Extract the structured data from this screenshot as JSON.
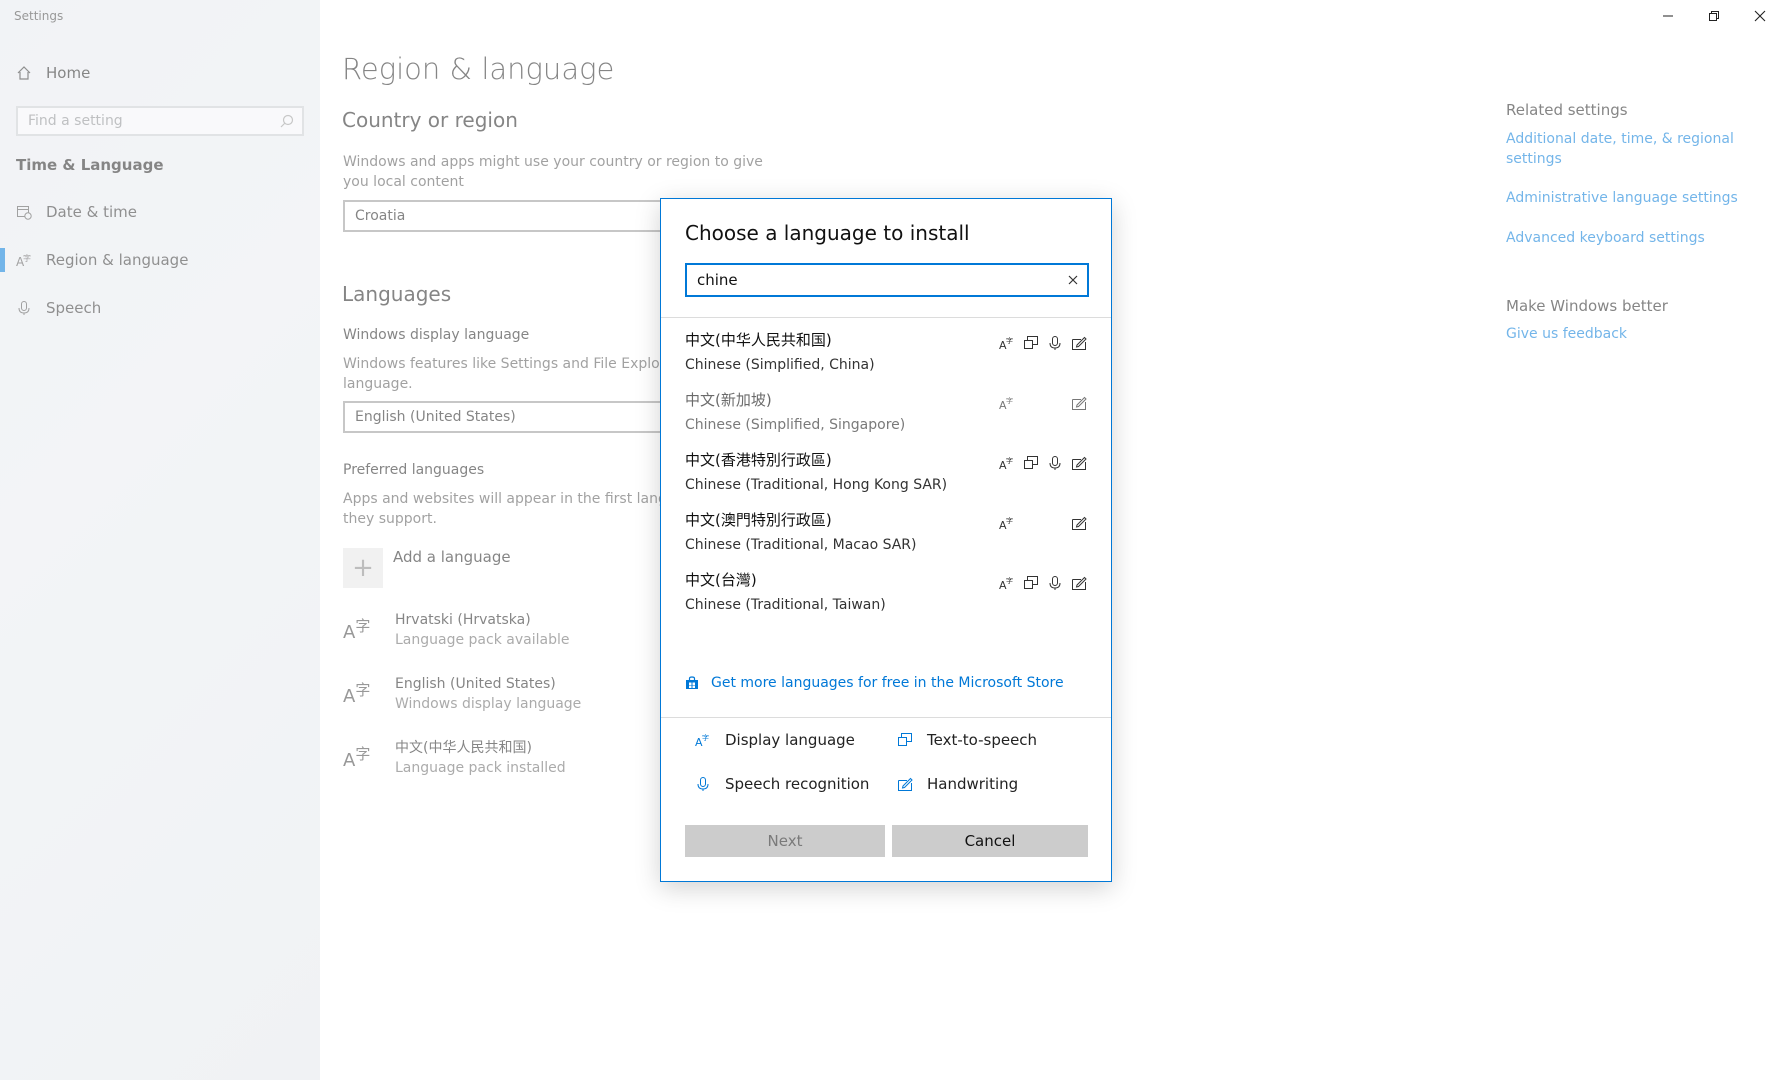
{
  "app_title": "Settings",
  "sidebar": {
    "home_label": "Home",
    "search_placeholder": "Find a setting",
    "section_heading": "Time & Language",
    "items": [
      {
        "label": "Date & time"
      },
      {
        "label": "Region & language"
      },
      {
        "label": "Speech"
      }
    ]
  },
  "main": {
    "title": "Region & language",
    "country_heading": "Country or region",
    "country_desc": "Windows and apps might use your country or region to give you local content",
    "country_value": "Croatia",
    "languages_heading": "Languages",
    "display_language_label": "Windows display language",
    "display_language_desc": "Windows features like Settings and File Explorer ... language.",
    "display_language_desc_line1": "Windows features like Settings and File Explorer",
    "display_language_desc_line2": "language.",
    "display_language_value": "English (United States)",
    "preferred_label": "Preferred languages",
    "preferred_desc_line1": "Apps and websites will appear in the first langua",
    "preferred_desc_line2": "they support.",
    "add_language_label": "Add a language",
    "languages": [
      {
        "name": "Hrvatski (Hrvatska)",
        "status": "Language pack available"
      },
      {
        "name": "English (United States)",
        "status": "Windows display language"
      },
      {
        "name": "中文(中华人民共和国)",
        "status": "Language pack installed"
      }
    ]
  },
  "related": {
    "heading": "Related settings",
    "links": [
      "Additional date, time, & regional settings",
      "Administrative language settings",
      "Advanced keyboard settings"
    ],
    "feedback_heading": "Make Windows better",
    "feedback_link": "Give us feedback"
  },
  "dialog": {
    "title": "Choose a language to install",
    "search_value": "chine",
    "results": [
      {
        "native": "中文(中华人民共和国)",
        "english": "Chinese (Simplified, China)",
        "caps": [
          "display",
          "tts",
          "speech",
          "handwriting"
        ]
      },
      {
        "native": "中文(新加坡)",
        "english": "Chinese (Simplified, Singapore)",
        "caps": [
          "display",
          "handwriting"
        ]
      },
      {
        "native": "中文(香港特別行政區)",
        "english": "Chinese (Traditional, Hong Kong SAR)",
        "caps": [
          "display",
          "tts",
          "speech",
          "handwriting"
        ]
      },
      {
        "native": "中文(澳門特別行政區)",
        "english": "Chinese (Traditional, Macao SAR)",
        "caps": [
          "display",
          "handwriting"
        ]
      },
      {
        "native": "中文(台灣)",
        "english": "Chinese (Traditional, Taiwan)",
        "caps": [
          "display",
          "tts",
          "speech",
          "handwriting"
        ]
      }
    ],
    "store_link": "Get more languages for free in the Microsoft Store",
    "legend": {
      "display": "Display language",
      "tts": "Text-to-speech",
      "speech": "Speech recognition",
      "handwriting": "Handwriting"
    },
    "next_label": "Next",
    "cancel_label": "Cancel"
  },
  "colors": {
    "accent": "#0078d7",
    "sidebar_bg": "#e6e9ee"
  }
}
